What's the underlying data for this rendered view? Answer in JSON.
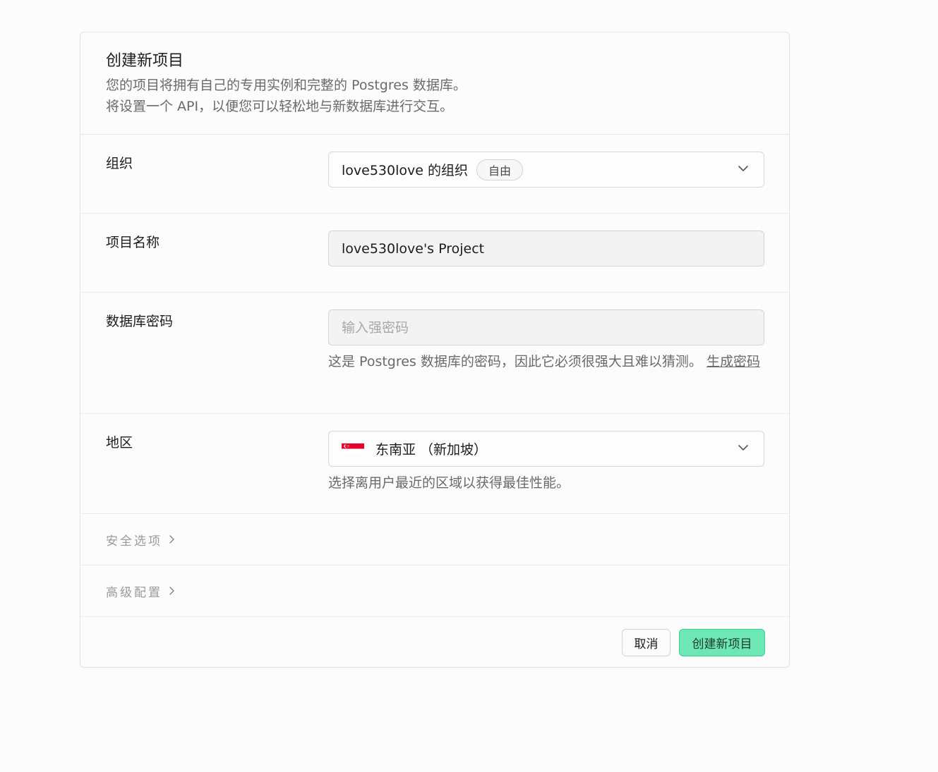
{
  "header": {
    "title": "创建新项目",
    "description_line1": "您的项目将拥有自己的专用实例和完整的 Postgres 数据库。",
    "description_line2": "将设置一个 API，以便您可以轻松地与新数据库进行交互。"
  },
  "organization": {
    "label": "组织",
    "value": "love530love 的组织",
    "plan_badge": "自由",
    "icon": "chevron-down-icon"
  },
  "project_name": {
    "label": "项目名称",
    "value": "love530love's Project"
  },
  "db_password": {
    "label": "数据库密码",
    "placeholder": "输入强密码",
    "help_text": "这是 Postgres 数据库的密码，因此它必须很强大且难以猜测。",
    "generate_link": "生成密码"
  },
  "region": {
    "label": "地区",
    "value": "东南亚 （新加坡）",
    "flag": "singapore-flag-icon",
    "help_text": "选择离用户最近的区域以获得最佳性能。",
    "flag_color": "#e4002b"
  },
  "sections": {
    "security_options": "安全选项",
    "advanced_config": "高级配置"
  },
  "footer": {
    "cancel_label": "取消",
    "create_label": "创建新项目"
  },
  "colors": {
    "primary_button": "#6ee7b7",
    "primary_border": "#3ecf8e"
  }
}
